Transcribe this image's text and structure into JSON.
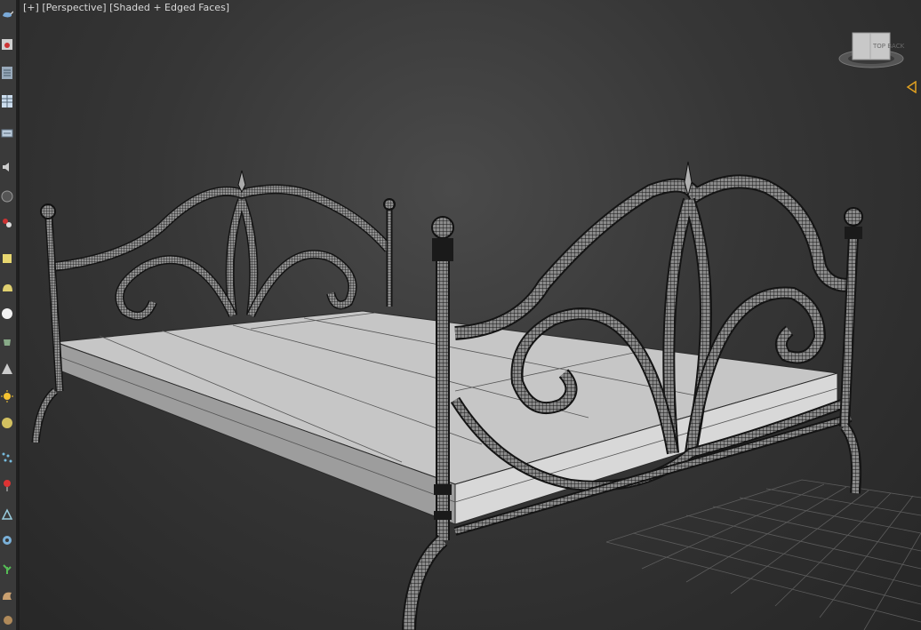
{
  "viewport": {
    "label_plus": "[+]",
    "label_view": "[Perspective]",
    "label_shading": "[Shaded + Edged Faces]"
  },
  "viewcube": {
    "face_label": "TOP  BACK"
  },
  "toolbar": {
    "icons": [
      "teapot-icon",
      "render-frame-icon",
      "layer-list-icon",
      "table-icon",
      "panel-icon",
      "ruler-icon",
      "speaker-icon",
      "sphere-icon",
      "cluster-icon",
      "box-icon",
      "capsule-icon",
      "globe-icon",
      "pot-icon",
      "cone-icon",
      "sun-icon",
      "lens-icon",
      "particles-icon",
      "pin-icon",
      "compass-icon",
      "gear-icon",
      "plant-icon",
      "shell-icon",
      "snail-icon"
    ]
  },
  "colors": {
    "toolbar_bg": "#3a3a3a",
    "viewport_bg": "#363636",
    "mesh_dark": "#1a1a1a",
    "mattress": "#c8c8c8",
    "grid": "#5c5c5c",
    "accent_marker": "#e0a020"
  }
}
